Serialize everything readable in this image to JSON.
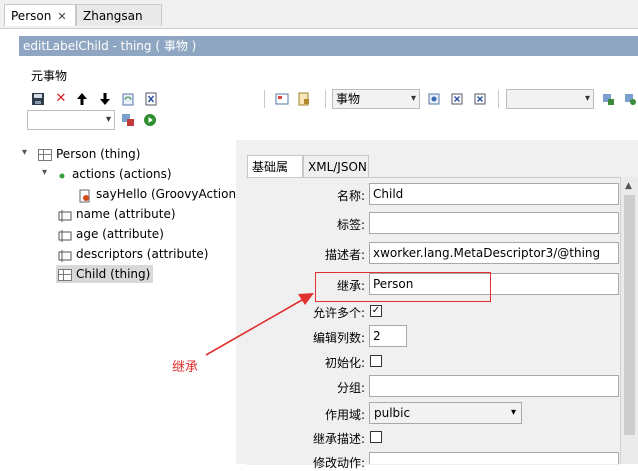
{
  "tabs": [
    {
      "label": "Person",
      "close": "✕"
    },
    {
      "label": "Zhangsan"
    }
  ],
  "editor": {
    "title": "editLabelChild - thing ( 事物 )"
  },
  "section": {
    "title": "元事物"
  },
  "toolbar": {
    "category_value": "事物",
    "empty_combo_value": ""
  },
  "tree": {
    "root": "Person (thing)",
    "actions": "actions (actions)",
    "sayhello": "sayHello (GroovyAction)",
    "name_attr": "name (attribute)",
    "age_attr": "age (attribute)",
    "descriptors_attr": "descriptors (attribute)",
    "child": "Child (thing)"
  },
  "panel_tabs": {
    "basic": "基础属性",
    "xml": "XML/JSON"
  },
  "form": {
    "name_label": "名称:",
    "name_value": "Child",
    "tag_label": "标签:",
    "tag_value": "",
    "descriptor_label": "描述者:",
    "descriptor_value": "xworker.lang.MetaDescriptor3/@thing",
    "extends_label": "继承:",
    "extends_value": "Person",
    "many_label": "允许多个:",
    "many_checked": "✓",
    "cols_label": "编辑列数:",
    "cols_value": "2",
    "init_label": "初始化:",
    "group_label": "分组:",
    "group_value": "",
    "scope_label": "作用域:",
    "scope_value": "pulbic",
    "inherit_desc_label": "继承描述:",
    "modify_action_label": "修改动作:"
  },
  "annotation": {
    "label": "继承",
    "color": "#e03030"
  }
}
